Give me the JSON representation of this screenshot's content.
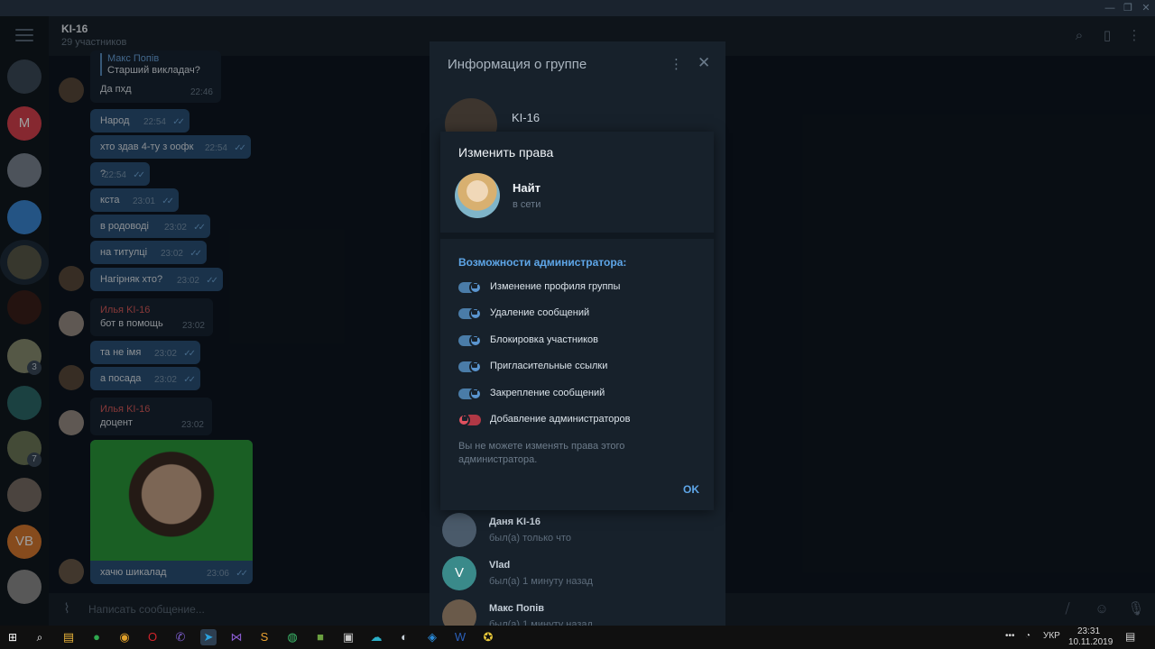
{
  "window": {
    "controls": [
      "—",
      "❐",
      "✕"
    ]
  },
  "header": {
    "title": "KI-16",
    "subtitle": "29 участников"
  },
  "rail": {
    "avatars": [
      {
        "letter": "",
        "color": "#3d4b59",
        "badge": ""
      },
      {
        "letter": "M",
        "color": "#d8414e",
        "badge": ""
      },
      {
        "letter": "",
        "color": "#7c8794",
        "badge": ""
      },
      {
        "letter": "",
        "color": "#3a88d6",
        "badge": ""
      },
      {
        "letter": "",
        "color": "#5a5a4a",
        "badge": ""
      },
      {
        "letter": "",
        "color": "#3a1f1a",
        "badge": ""
      },
      {
        "letter": "",
        "color": "#8a8f72",
        "badge": "3"
      },
      {
        "letter": "",
        "color": "#2d6a6a",
        "badge": ""
      },
      {
        "letter": "",
        "color": "#6f7a5a",
        "badge": "7"
      },
      {
        "letter": "",
        "color": "#7a6f66",
        "badge": ""
      },
      {
        "letter": "VB",
        "color": "#d87a2f",
        "badge": ""
      },
      {
        "letter": "",
        "color": "#8e8e8e",
        "badge": ""
      }
    ]
  },
  "messages": [
    {
      "type": "in",
      "reply_name": "Макс Попів",
      "reply_text": "Старший викладач?",
      "text": "Да пхд",
      "time": "22:46"
    },
    {
      "type": "out",
      "text": "Народ",
      "time": "22:54"
    },
    {
      "type": "out",
      "text": "хто здав 4-ту з оофк",
      "time": "22:54"
    },
    {
      "type": "out",
      "text": "?",
      "time": "22:54"
    },
    {
      "type": "out",
      "text": "кста",
      "time": "23:01"
    },
    {
      "type": "out",
      "text": "в родоводі",
      "time": "23:02"
    },
    {
      "type": "out",
      "text": "на титулці",
      "time": "23:02"
    },
    {
      "type": "out",
      "text": "Нагірняк хто?",
      "time": "23:02"
    },
    {
      "type": "in",
      "author": "Илья KI-16",
      "text": "бот в помощь",
      "time": "23:02"
    },
    {
      "type": "out",
      "text": "та не імя",
      "time": "23:02"
    },
    {
      "type": "out",
      "text": "а посада",
      "time": "23:02"
    },
    {
      "type": "in",
      "author": "Илья KI-16",
      "text": "доцент",
      "time": "23:02"
    },
    {
      "type": "out",
      "text": "хачю шикалад",
      "time": "23:06"
    }
  ],
  "composer": {
    "placeholder": "Написать сообщение..."
  },
  "group_info": {
    "title": "Информация о группе",
    "group_name": "KI-16",
    "members": [
      {
        "name": "Даня KI-16",
        "status": "был(а) только что",
        "letter": "",
        "color": "#4a5a6a"
      },
      {
        "name": "Vlad",
        "status": "был(а) 1 минуту назад",
        "letter": "V",
        "color": "#3a8a8a"
      },
      {
        "name": "Макс Попів",
        "status": "был(а) 1 минуту назад",
        "letter": "",
        "color": "#6a5a4a"
      }
    ]
  },
  "dialog": {
    "title": "Изменить права",
    "user_name": "Найт",
    "user_status": "в сети",
    "section_title": "Возможности администратора:",
    "permissions": [
      {
        "label": "Изменение профиля группы",
        "enabled": true
      },
      {
        "label": "Удаление сообщений",
        "enabled": true
      },
      {
        "label": "Блокировка участников",
        "enabled": true
      },
      {
        "label": "Пригласительные ссылки",
        "enabled": true
      },
      {
        "label": "Закрепление сообщений",
        "enabled": true
      },
      {
        "label": "Добавление администраторов",
        "enabled": false
      }
    ],
    "note": "Вы не можете изменять права этого администратора.",
    "ok_label": "OK"
  },
  "taskbar": {
    "apps": [
      {
        "glyph": "▤",
        "color": "#e8b33a",
        "active": false
      },
      {
        "glyph": "●",
        "color": "#2fa84f",
        "active": false
      },
      {
        "glyph": "◉",
        "color": "#e0a02a",
        "active": false
      },
      {
        "glyph": "O",
        "color": "#d2232a",
        "active": false
      },
      {
        "glyph": "✆",
        "color": "#7b5cc9",
        "active": false
      },
      {
        "glyph": "➤",
        "color": "#2aa3e0",
        "active": true
      },
      {
        "glyph": "⋈",
        "color": "#8a5cd0",
        "active": false
      },
      {
        "glyph": "S",
        "color": "#e8a030",
        "active": false
      },
      {
        "glyph": "◍",
        "color": "#3cb86a",
        "active": false
      },
      {
        "glyph": "■",
        "color": "#6aa040",
        "active": false
      },
      {
        "glyph": "▣",
        "color": "#c9c9c9",
        "active": false
      },
      {
        "glyph": "☁",
        "color": "#2bb0c8",
        "active": false
      },
      {
        "glyph": "◐",
        "color": "#c9d2da",
        "active": false
      },
      {
        "glyph": "◈",
        "color": "#2a8ad8",
        "active": false
      },
      {
        "glyph": "W",
        "color": "#2b5fb8",
        "active": false
      },
      {
        "glyph": "✪",
        "color": "#e8c83a",
        "active": false
      }
    ],
    "language": "УКР",
    "time": "23:31",
    "date": "10.11.2019"
  }
}
